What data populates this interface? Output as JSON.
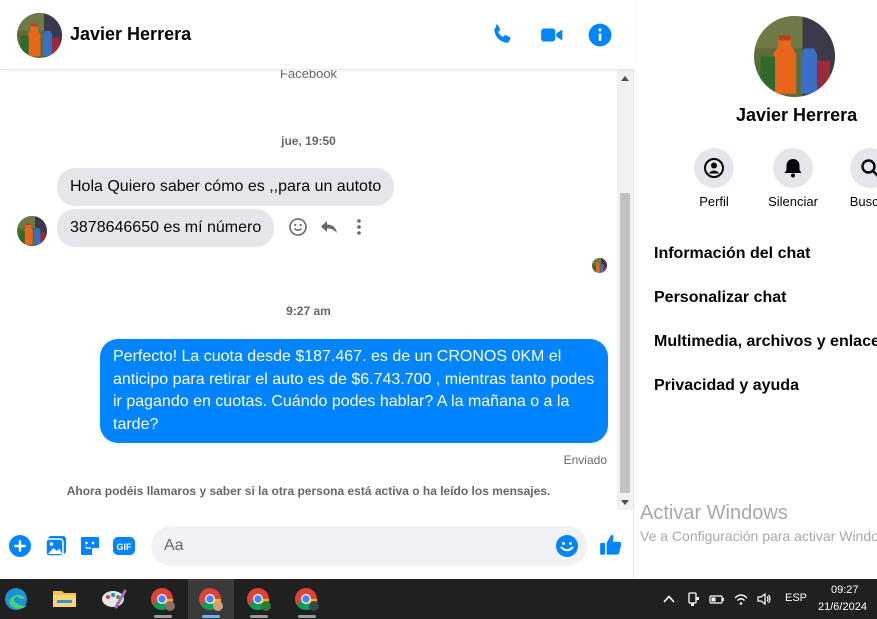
{
  "contact": {
    "name": "Javier Herrera"
  },
  "header": {
    "icons": [
      "phone-icon",
      "video-camera-icon",
      "info-icon"
    ]
  },
  "conversation": {
    "source_label": "Facebook",
    "timestamp_1": "jue, 19:50",
    "incoming": [
      "Hola Quiero saber cómo es ,,para un autoto",
      "3878646650 es mí número"
    ],
    "timestamp_2": "9:27 am",
    "outgoing": "Perfecto! La cuota desde $187.467. es de un CRONOS 0KM el anticipo para retirar el auto es de $6.743.700 , mientras tanto podes ir pagando en cuotas. Cuándo podes hablar? A la mañana o a la tarde?",
    "sent_status": "Enviado",
    "notice": "Ahora podéis llamaros y saber si la otra persona está activa o ha leído los mensajes."
  },
  "composer": {
    "placeholder": "Aa",
    "icons": [
      "add-icon",
      "photo-icon",
      "sticker-icon",
      "gif-icon",
      "emoji-icon",
      "like-icon"
    ],
    "gif_label": "GIF"
  },
  "info_panel": {
    "name": "Javier Herrera",
    "actions": [
      {
        "label": "Perfil",
        "icon": "profile-icon"
      },
      {
        "label": "Silenciar",
        "icon": "bell-icon"
      },
      {
        "label": "Buscar",
        "icon": "search-icon"
      }
    ],
    "items": [
      "Información del chat",
      "Personalizar chat",
      "Multimedia, archivos y enlaces",
      "Privacidad y ayuda"
    ]
  },
  "watermark": {
    "title": "Activar Windows",
    "subtitle": "Ve a Configuración para activar Windows."
  },
  "taskbar": {
    "apps": [
      "edge",
      "file-explorer",
      "paint",
      "chrome",
      "chrome",
      "chrome",
      "chrome"
    ],
    "language": "ESP",
    "time": "09:27",
    "date": "21/6/2024"
  },
  "colors": {
    "accent": "#0084ff",
    "bubble_in": "#e4e6eb",
    "taskbar": "#202020"
  }
}
